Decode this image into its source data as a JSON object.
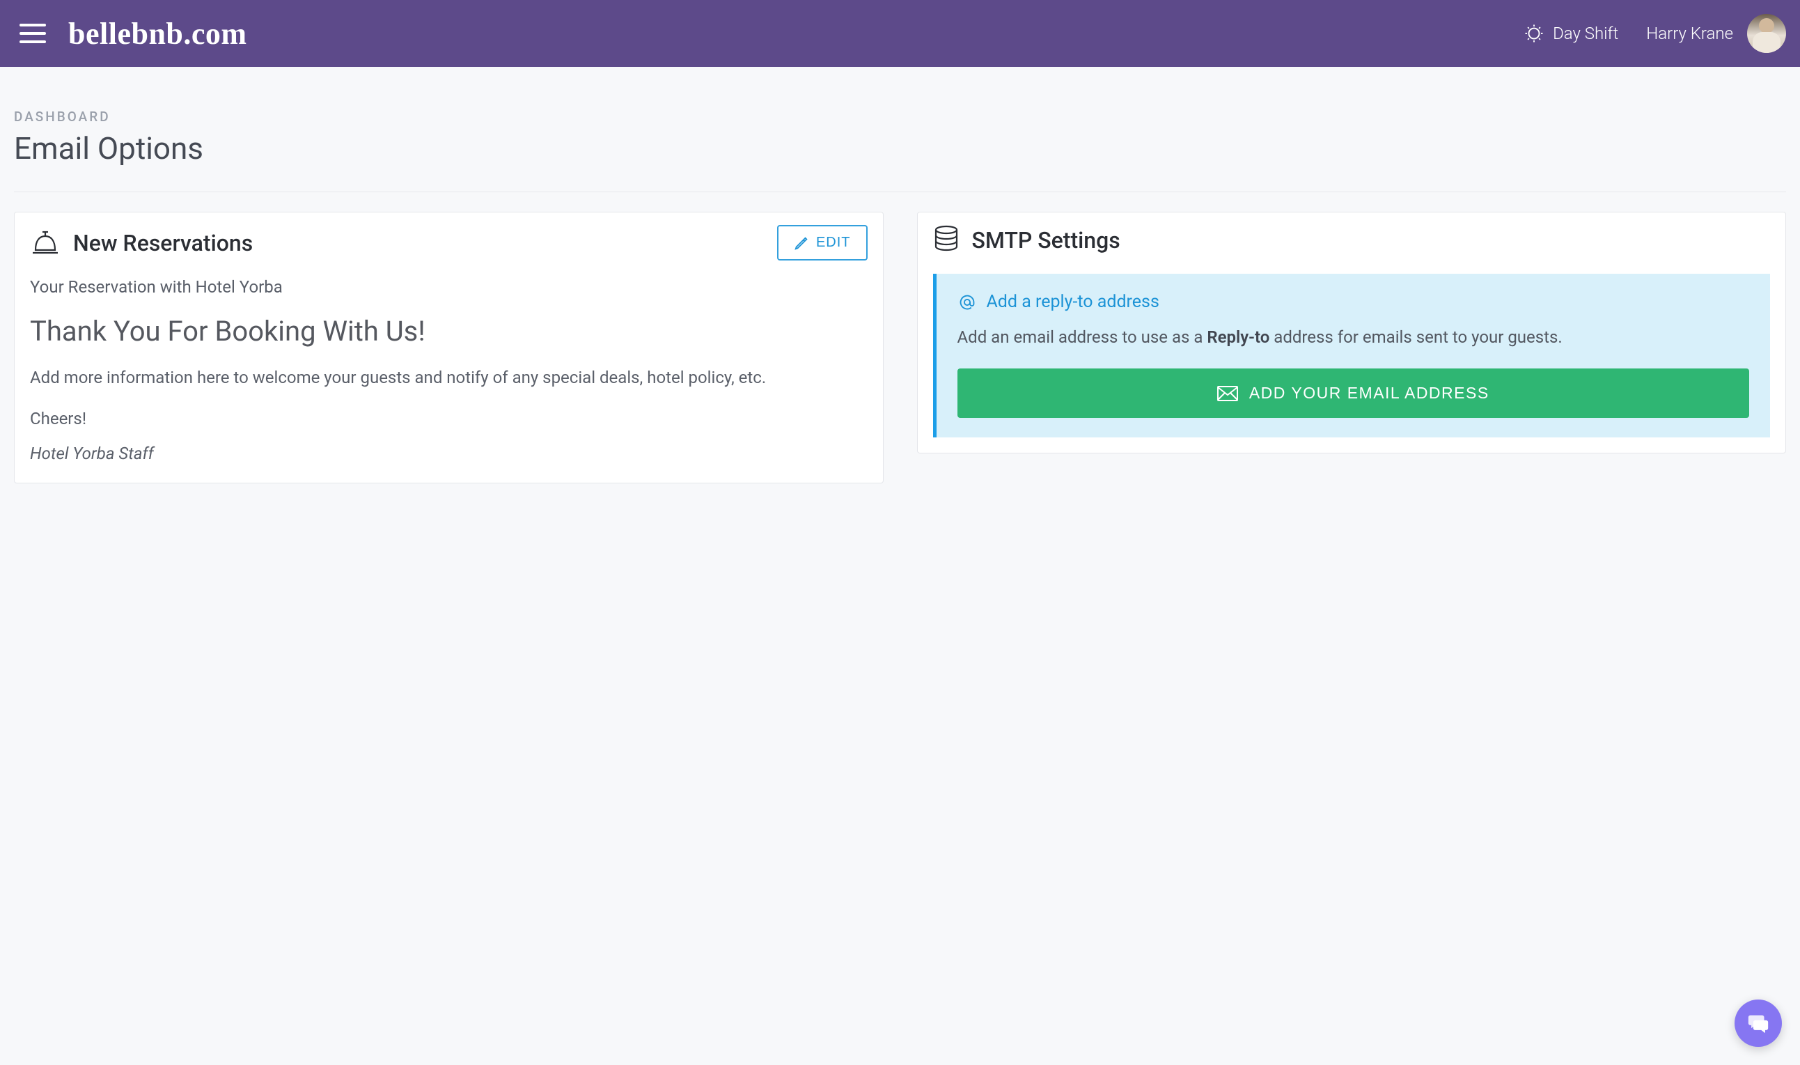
{
  "header": {
    "logo": "bellebnb.com",
    "shift_label": "Day Shift",
    "user_name": "Harry Krane"
  },
  "page": {
    "breadcrumb": "DASHBOARD",
    "title": "Email Options"
  },
  "reservations_card": {
    "title": "New Reservations",
    "edit_label": "EDIT",
    "subject": "Your Reservation with Hotel Yorba",
    "headline": "Thank You For Booking With Us!",
    "body": "Add more information here to welcome your guests and notify of any special deals, hotel policy, etc.",
    "signoff": "Cheers!",
    "signature": "Hotel Yorba Staff"
  },
  "smtp_card": {
    "title": "SMTP Settings",
    "callout_title": "Add a reply-to address",
    "callout_body_prefix": "Add an email address to use as a ",
    "callout_body_strong": "Reply-to",
    "callout_body_suffix": " address for emails sent to your guests.",
    "button_label": "ADD YOUR EMAIL ADDRESS"
  }
}
